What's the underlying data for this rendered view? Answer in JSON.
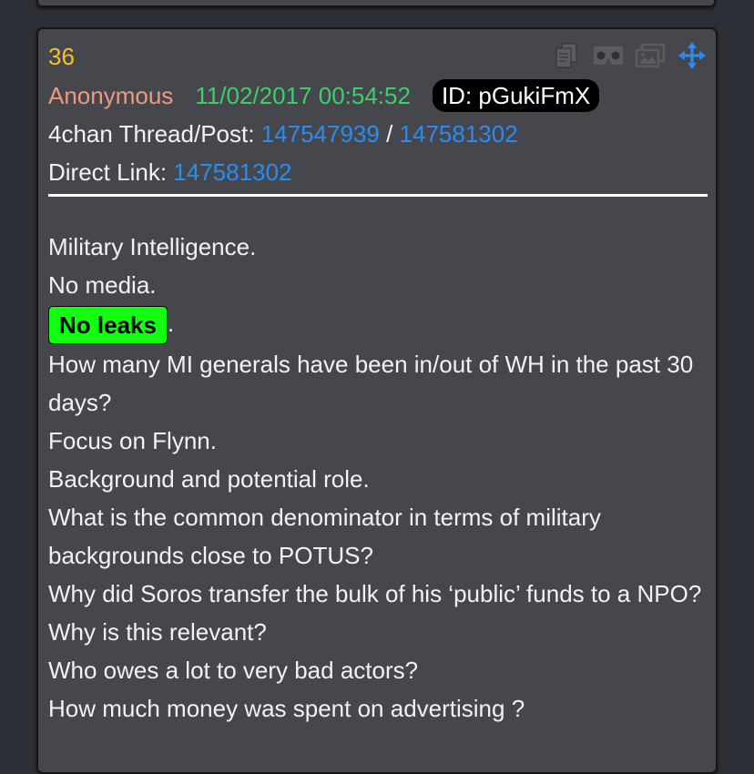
{
  "post": {
    "number": "36",
    "author": "Anonymous",
    "timestamp": "11/02/2017 00:54:52",
    "id_label": "ID: pGukiFmX",
    "thread_label": "4chan Thread/Post:",
    "thread_id": "147547939",
    "separator": "/",
    "post_id": "147581302",
    "direct_label": "Direct Link:",
    "direct_id": "147581302"
  },
  "toolbar": {
    "icons": [
      "copy-icon",
      "vr-headset-icon",
      "images-icon",
      "move-icon"
    ],
    "accent_color": "#2a8cf0"
  },
  "body": {
    "lines": [
      "Military Intelligence.",
      "No media.",
      "How many MI generals have been in/out of WH in the past 30 days?",
      "Focus on Flynn.",
      "Background and potential role.",
      "What is the common denominator in terms of military backgrounds close to POTUS?",
      "Why did Soros transfer the bulk of his ‘public’ funds to a NPO?",
      "Why is this relevant?",
      "Who owes a lot to very bad actors?",
      "How much money was spent on advertising ?"
    ],
    "highlight_text": "No leaks",
    "highlight_suffix": ".",
    "highlight_color": "#12ff12"
  },
  "colors": {
    "post_number": "#f2c12e",
    "author": "#ee9a80",
    "timestamp": "#3ccf6a",
    "link": "#2a8cf0",
    "card_bg": "#46474c",
    "page_bg": "#2d2f36"
  }
}
